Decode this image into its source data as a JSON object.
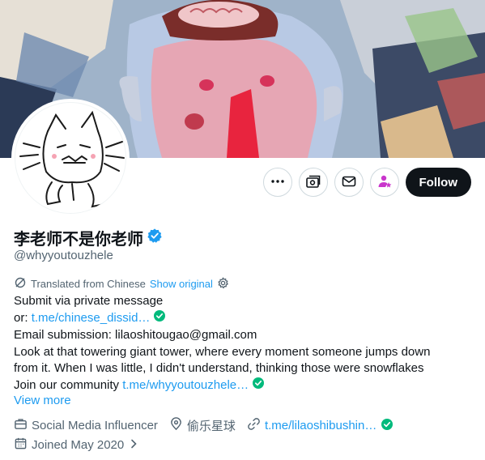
{
  "profile": {
    "display_name": "李老师不是你老师",
    "handle": "@whyyoutouzhele"
  },
  "actions": {
    "more_icon": "ellipsis-icon",
    "subscribe_icon": "subscriptions-icon",
    "message_icon": "envelope-icon",
    "creator_icon": "person-star-icon",
    "follow_label": "Follow"
  },
  "translation": {
    "label": "Translated from Chinese",
    "show_original": "Show original",
    "settings_icon": "gear-icon"
  },
  "bio": {
    "line1": "Submit via private message",
    "line2_prefix": "or: ",
    "line2_link": "t.me/chinese_dissid…",
    "line3": "Email submission: lilaoshitougao@gmail.com",
    "line4": "Look at that towering giant tower, where every moment someone jumps down",
    "line5": "from it. When I was little, I didn't understand, thinking those were snowflakes",
    "line6_prefix": "Join our community ",
    "line6_link": "t.me/whyyoutouzhele…"
  },
  "view_more": "View more",
  "meta": {
    "category": "Social Media Influencer",
    "location": "偷乐星球",
    "website": "t.me/lilaoshibushin…",
    "joined": "Joined May 2020"
  },
  "colors": {
    "accent": "#1d9bf0",
    "verified_blue": "#1d9bf0",
    "link_verified_green": "#00ba7c",
    "creator_pink": "#c936cc"
  }
}
